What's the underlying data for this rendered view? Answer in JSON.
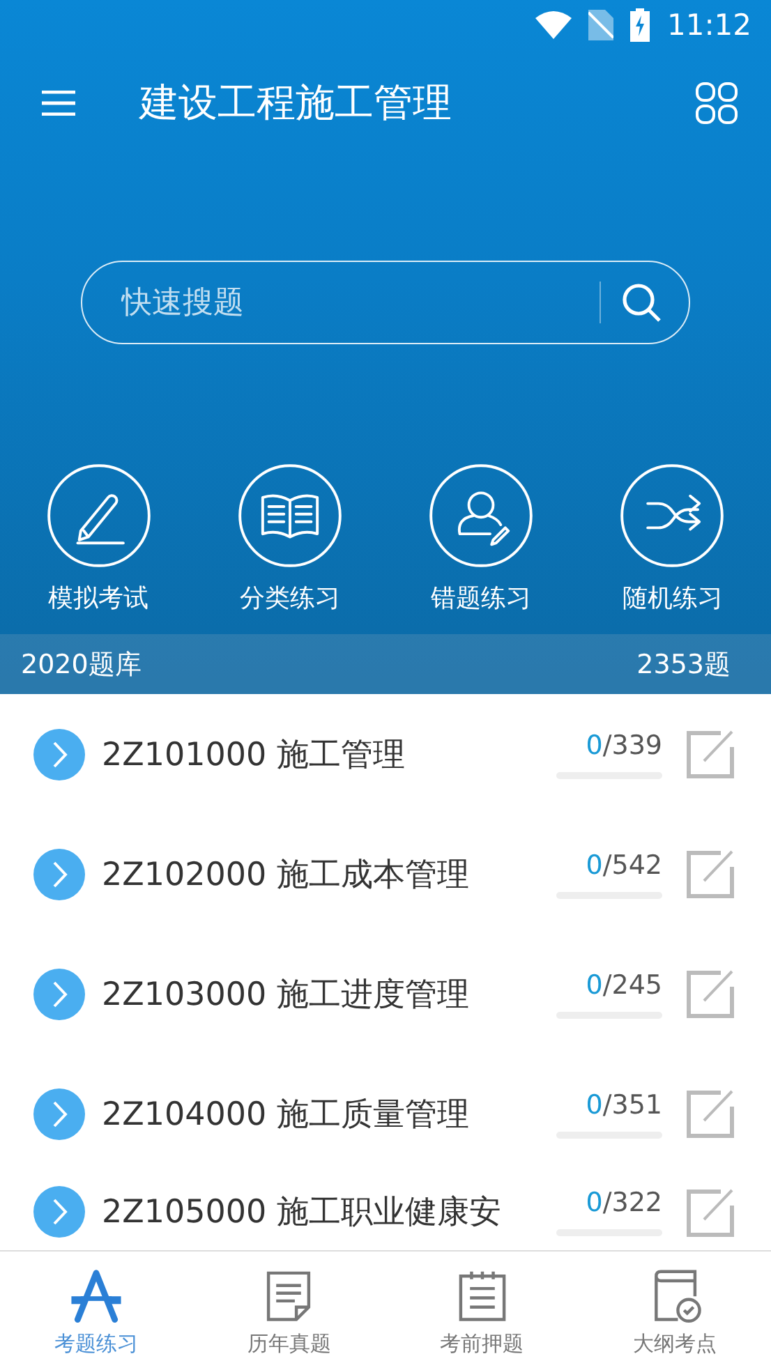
{
  "status_bar": {
    "time": "11:12"
  },
  "app_bar": {
    "title": "建设工程施工管理"
  },
  "search": {
    "placeholder": "快速搜题"
  },
  "features": [
    {
      "label": "模拟考试"
    },
    {
      "label": "分类练习"
    },
    {
      "label": "错题练习"
    },
    {
      "label": "随机练习"
    }
  ],
  "bank_bar": {
    "name": "2020题库",
    "count": "2353题"
  },
  "chapters": [
    {
      "title": "2Z101000 施工管理",
      "done": "0",
      "total": "/339",
      "level": 0
    },
    {
      "title": "2Z102000 施工成本管理",
      "done": "0",
      "total": "/542",
      "level": 0
    },
    {
      "title": "2Z103000 施工进度管理",
      "done": "0",
      "total": "/245",
      "level": 0
    },
    {
      "title": "2Z104000 施工质量管理",
      "done": "0",
      "total": "/351",
      "level": 0
    },
    {
      "title": "2Z105000 施工职业健康安",
      "done": "0",
      "total": "/322",
      "level": 0
    }
  ],
  "bottom_nav": [
    {
      "label": "考题练习",
      "selected": true
    },
    {
      "label": "历年真题",
      "selected": false
    },
    {
      "label": "考前押题",
      "selected": false
    },
    {
      "label": "大纲考点",
      "selected": false
    }
  ]
}
